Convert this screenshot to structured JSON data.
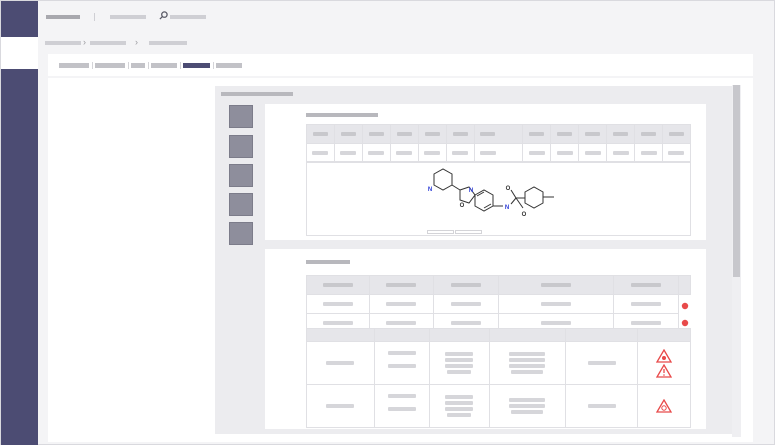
{
  "app": {
    "title": "",
    "menu": "",
    "search_placeholder": ""
  },
  "breadcrumb": [],
  "tabs": [],
  "panel": {
    "title": ""
  },
  "structure_card": {
    "title": "",
    "header": [],
    "row": []
  },
  "molecule": {
    "atoms": [
      "N",
      "N",
      "O",
      "N",
      "O",
      "O"
    ]
  },
  "safety_card": {
    "title": "",
    "table1_header": [],
    "table2_header": []
  },
  "colors": {
    "sidebar": "#4c4c73",
    "active_tab": "#4c4c73",
    "hazard": "#e84a4a",
    "atom_n": "#2b3bd6",
    "atom_o": "#333333"
  },
  "icons": [
    "search-icon",
    "remove-icon",
    "hazard-flame-icon",
    "hazard-exclamation-icon",
    "hazard-explosion-icon"
  ]
}
